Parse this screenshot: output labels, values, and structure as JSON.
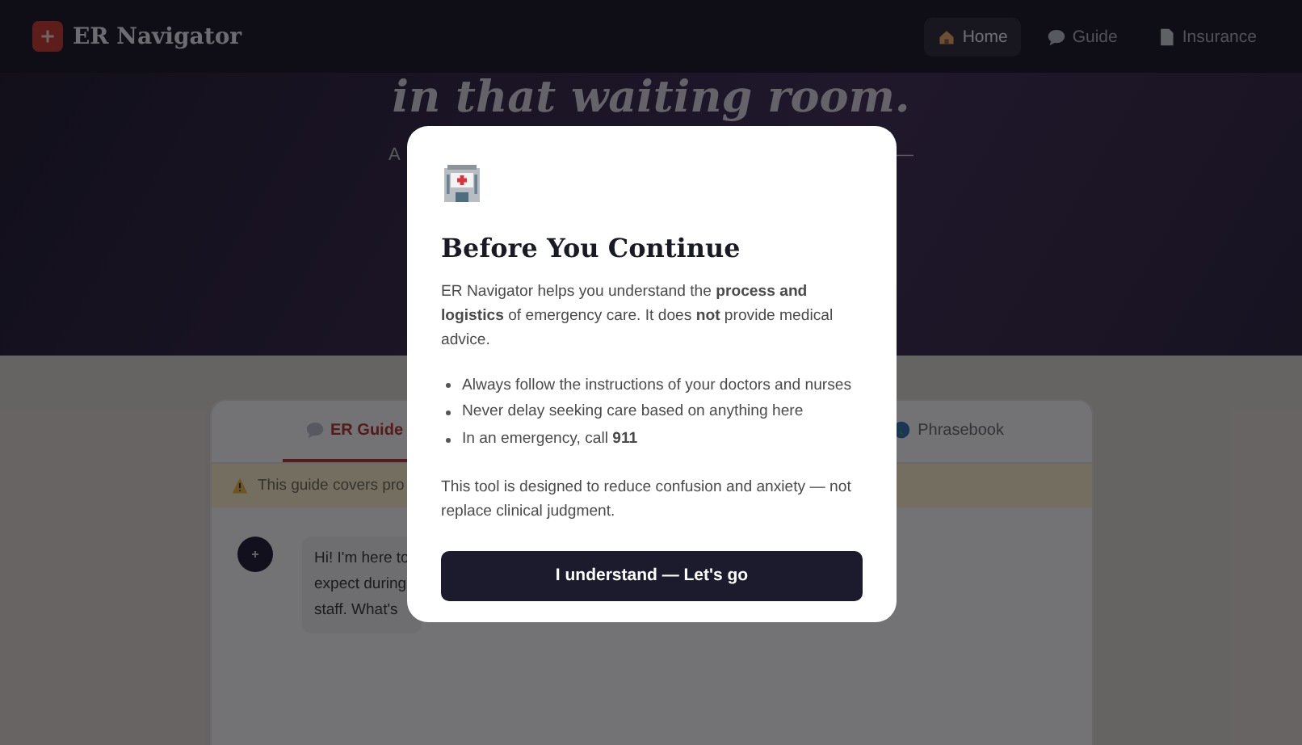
{
  "header": {
    "brand": "ER Navigator",
    "nav": [
      {
        "label": "Home",
        "selected": true
      },
      {
        "label": "Guide",
        "selected": false
      },
      {
        "label": "Insurance",
        "selected": false
      }
    ]
  },
  "hero": {
    "headline": "in that waiting room.",
    "subtitle_start": "A",
    "subtitle_end": "—"
  },
  "guide": {
    "tabs": [
      {
        "label": "ER Guide",
        "selected": true
      },
      {
        "label": "Phrasebook",
        "selected": false
      }
    ],
    "notice": "This guide covers pro",
    "message_lines": [
      "Hi! I'm here to",
      "expect during",
      "staff. What's"
    ]
  },
  "modal": {
    "title": "Before You Continue",
    "intro": "ER Navigator helps you understand the **process and logistics** of emergency care. It does **not** provide medical advice.",
    "points": [
      "Always follow the instructions of your doctors and nurses",
      "Never delay seeking care based on anything here",
      "In an emergency, call **911**"
    ],
    "note": "This tool is designed to reduce confusion and anxiety — not replace clinical judgment.",
    "button": "I understand — Let's go"
  }
}
